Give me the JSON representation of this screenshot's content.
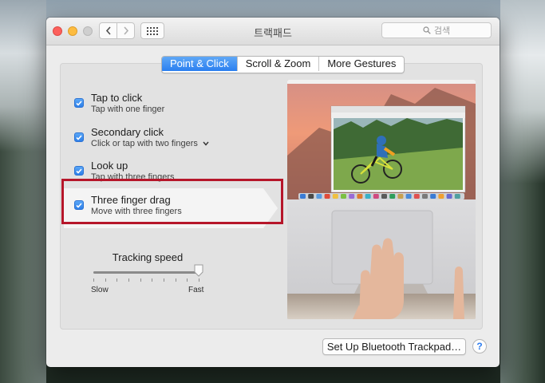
{
  "window": {
    "title": "트랙패드"
  },
  "toolbar": {
    "back_icon": "chevron-left-icon",
    "forward_icon": "chevron-right-icon",
    "grid_icon": "grid-icon"
  },
  "search": {
    "placeholder": "검색"
  },
  "tabs": [
    {
      "label": "Point & Click",
      "active": true
    },
    {
      "label": "Scroll & Zoom",
      "active": false
    },
    {
      "label": "More Gestures",
      "active": false
    }
  ],
  "options": [
    {
      "title": "Tap to click",
      "subtitle": "Tap with one finger",
      "checked": true
    },
    {
      "title": "Secondary click",
      "subtitle": "Click or tap with two fingers",
      "checked": true,
      "has_dropdown": true
    },
    {
      "title": "Look up",
      "subtitle": "Tap with three fingers",
      "checked": true
    },
    {
      "title": "Three finger drag",
      "subtitle": "Move with three fingers",
      "checked": true,
      "selected": true
    }
  ],
  "tracking": {
    "title": "Tracking speed",
    "min_label": "Slow",
    "max_label": "Fast",
    "value_fraction": 1.0
  },
  "footer": {
    "setup_label": "Set Up Bluetooth Trackpad…",
    "help_label": "?"
  },
  "colors": {
    "accent": "#2b7ff0",
    "annotation": "#b6162a"
  }
}
